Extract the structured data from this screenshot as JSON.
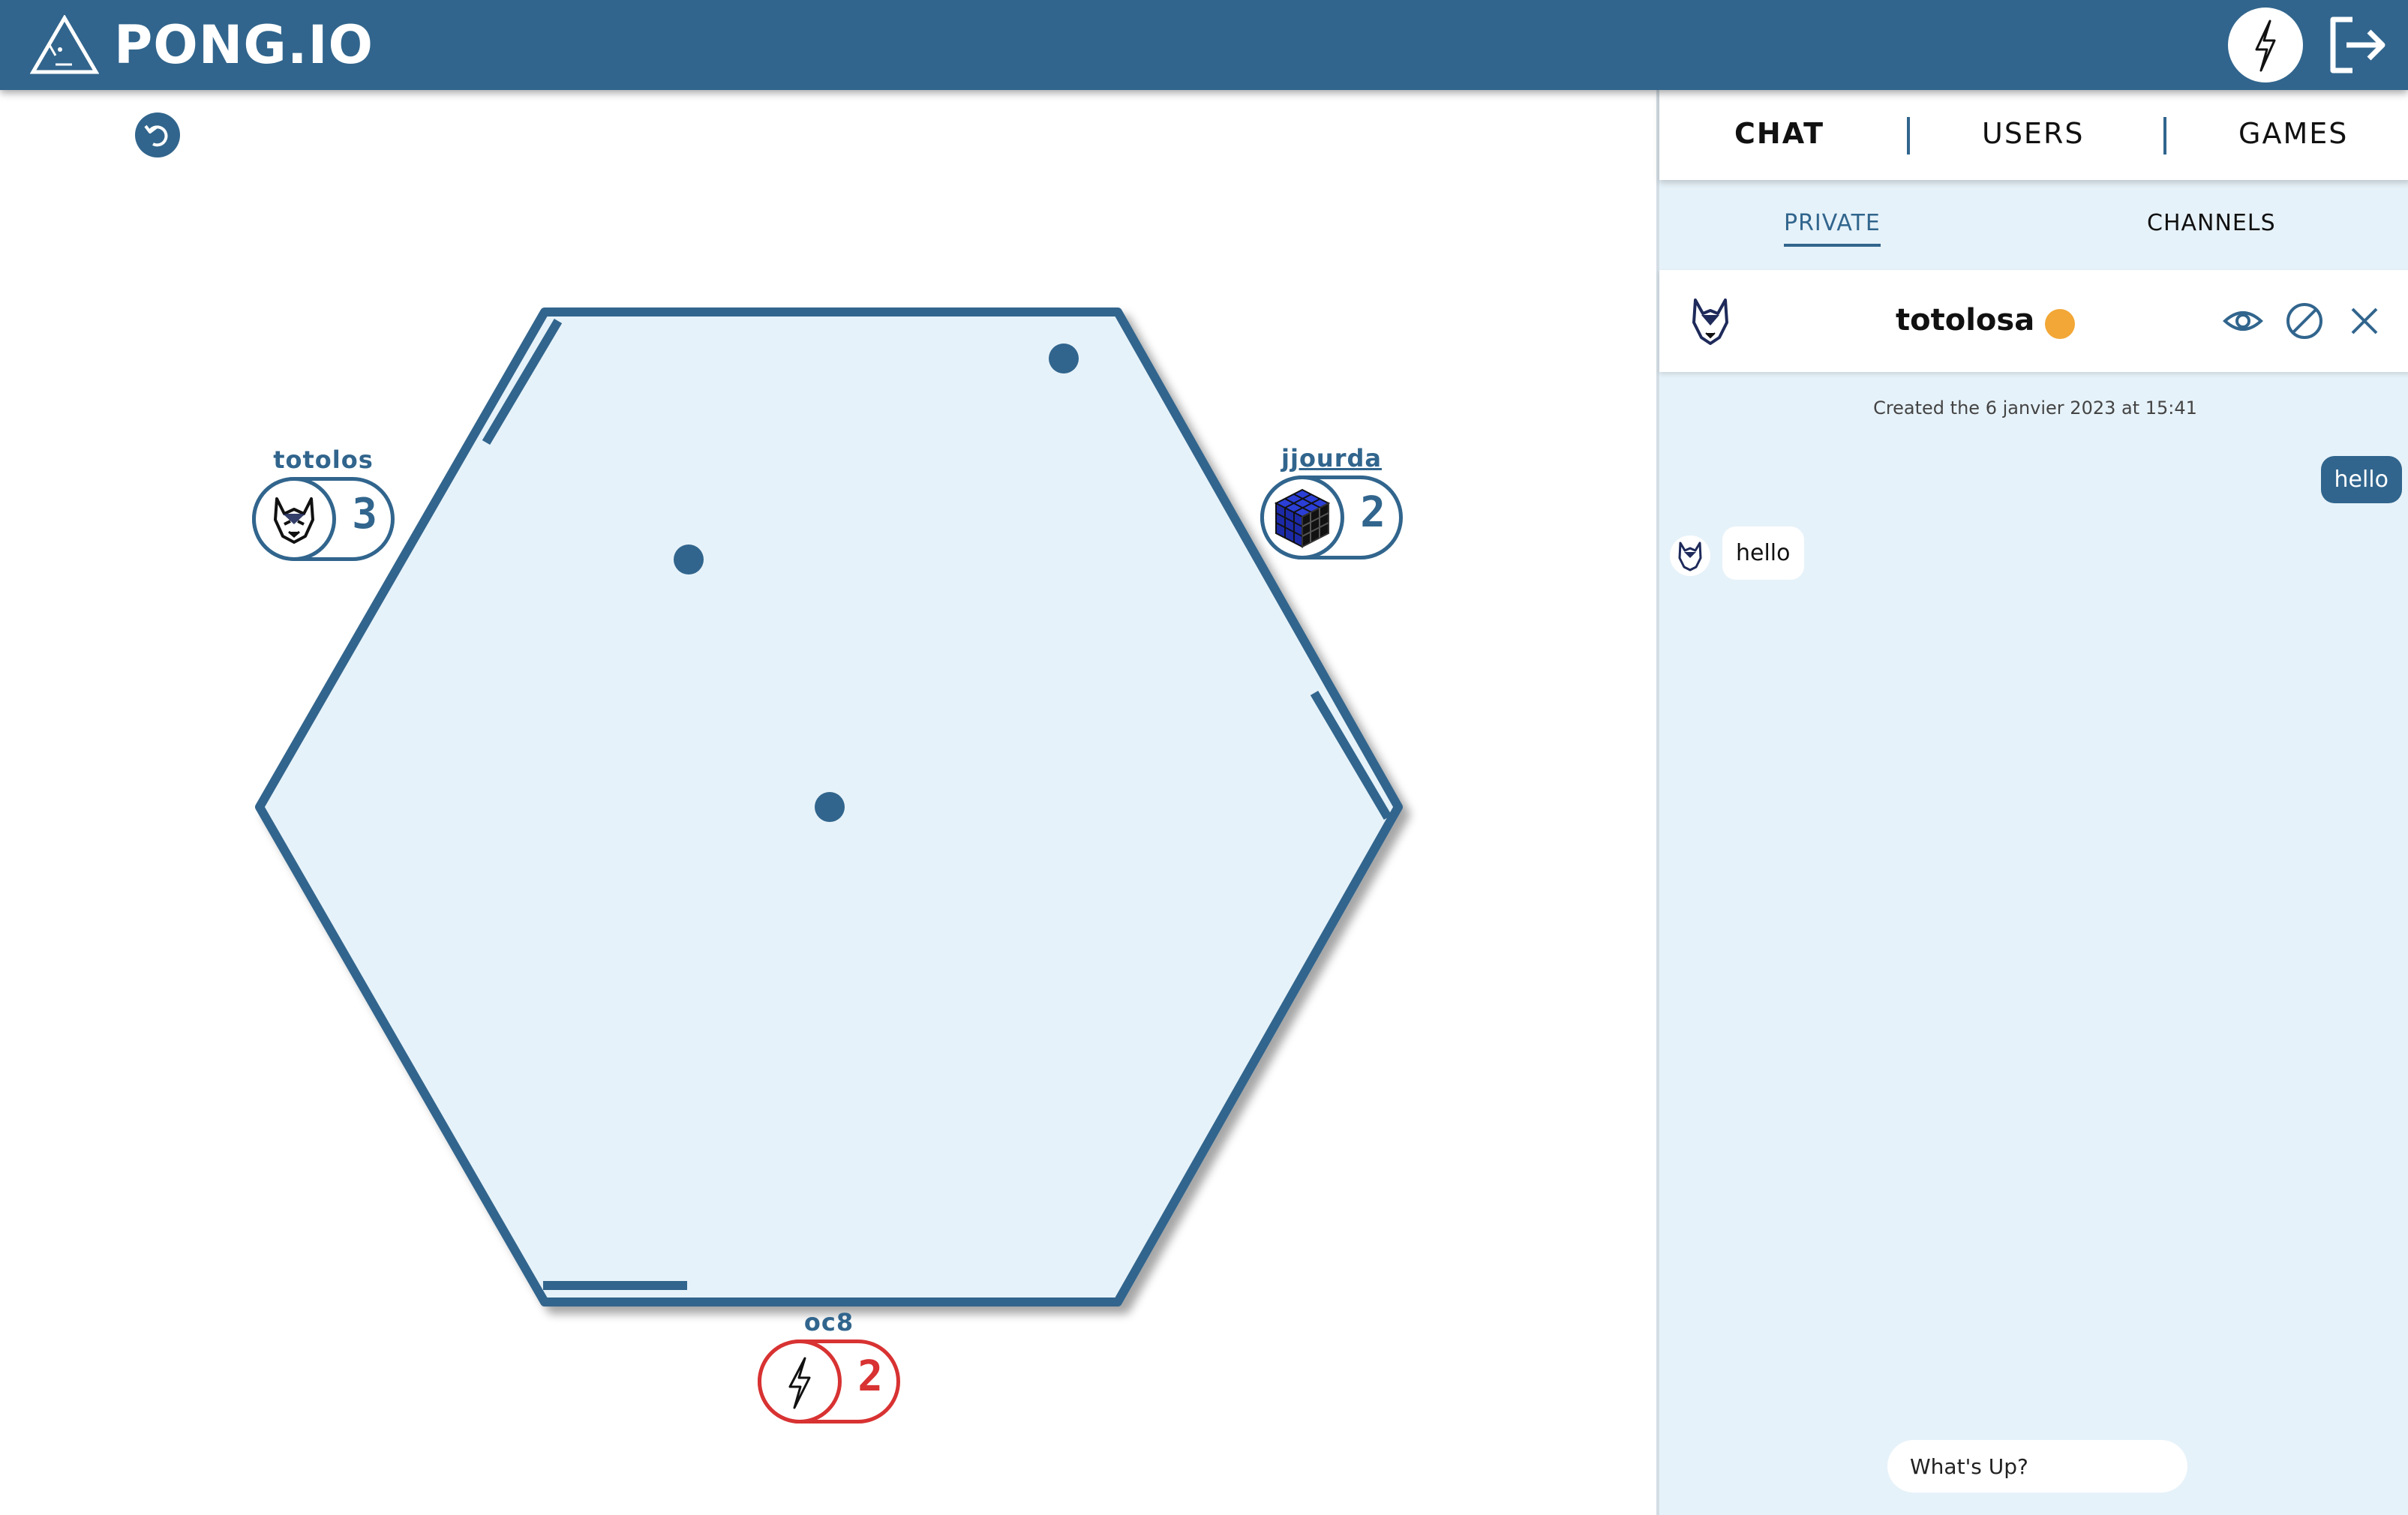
{
  "app": {
    "title": "PONG.IO",
    "logo_icon": "triangle-pong-logo-icon",
    "header_avatar_icon": "lightning-bolt-icon",
    "logout_icon": "logout-icon",
    "back_icon": "back-arrow-icon"
  },
  "game": {
    "arena": "hexagon",
    "players": [
      {
        "name": "totolos",
        "score": "3",
        "avatar_icon": "wolf-icon",
        "color": "#31658d"
      },
      {
        "name": "jjourda",
        "score": "2",
        "avatar_icon": "rubiks-cube-icon",
        "color": "#31658d"
      },
      {
        "name": "oc8",
        "score": "2",
        "avatar_icon": "lightning-bolt-icon",
        "color": "#d83232"
      }
    ],
    "ball_count": 3
  },
  "panel": {
    "main_tabs": [
      {
        "label": "CHAT",
        "active": true
      },
      {
        "label": "USERS",
        "active": false
      },
      {
        "label": "GAMES",
        "active": false
      }
    ],
    "sub_tabs": [
      {
        "label": "PRIVATE",
        "active": true
      },
      {
        "label": "CHANNELS",
        "active": false
      }
    ],
    "chat": {
      "contact_name": "totolosa",
      "contact_status_color": "#f2a736",
      "contact_avatar_icon": "wolf-icon",
      "actions": [
        "eye-icon",
        "block-icon",
        "close-icon"
      ],
      "created_text": "Created the 6 janvier 2023 at 15:41",
      "messages": [
        {
          "direction": "out",
          "text": "hello"
        },
        {
          "direction": "in",
          "text": "hello"
        }
      ],
      "input_placeholder": "What's Up?",
      "input_value": ""
    }
  },
  "colors": {
    "primary": "#31658d",
    "red": "#d83232",
    "arena_fill": "#e6f2f9",
    "panel_bg": "#e6f2f9"
  }
}
